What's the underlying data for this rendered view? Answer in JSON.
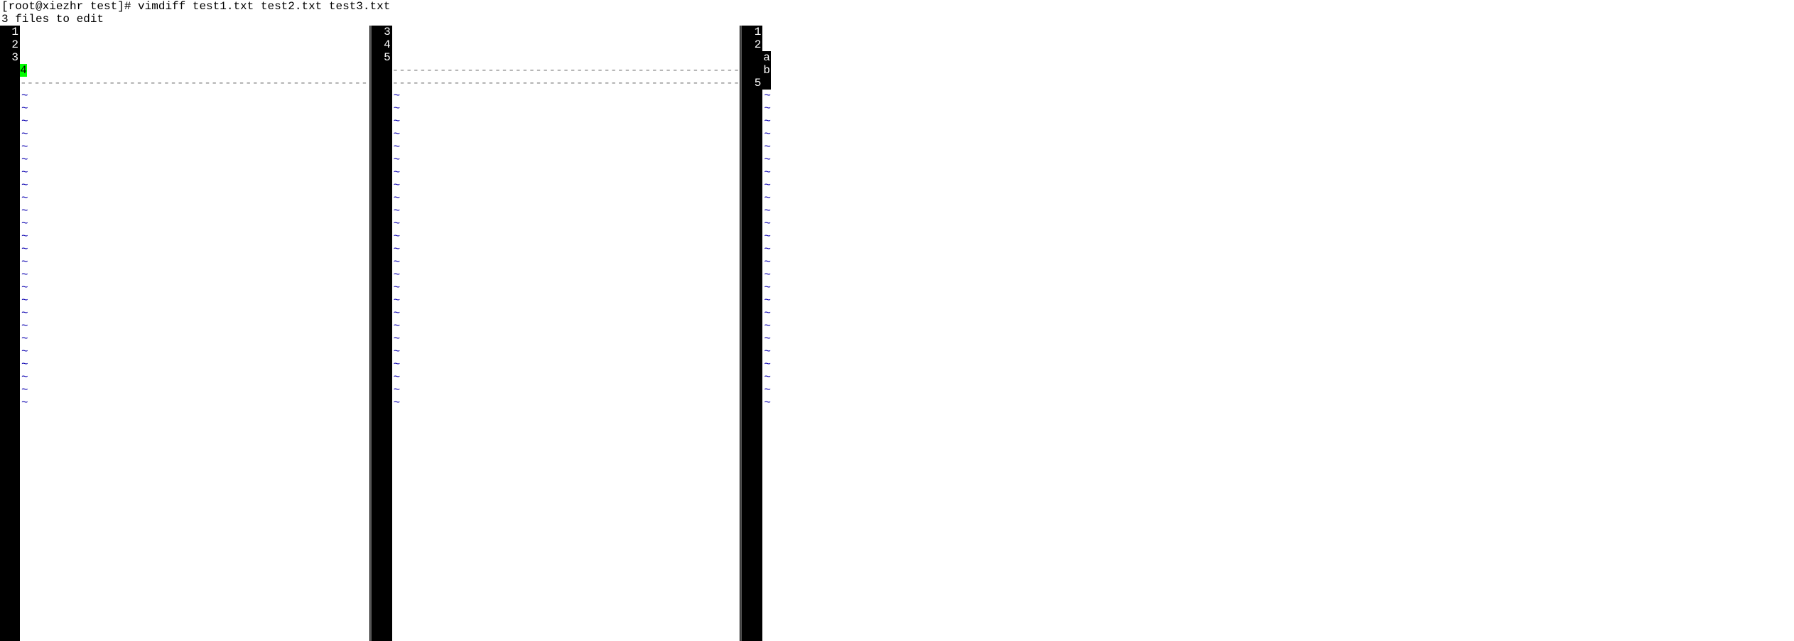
{
  "prompt": "[root@xiezhr test]# vimdiff test1.txt test2.txt test3.txt",
  "message": "3 files to edit",
  "tilde": "~",
  "pane1": {
    "ln1": "1",
    "ln2": "2",
    "ln3": "3",
    "ln4": "4"
  },
  "pane2": {
    "ln1": "3",
    "ln2": "4",
    "ln3": "5"
  },
  "pane3": {
    "ln1": "1",
    "ln2": "2",
    "ln3": "a",
    "ln4": "b",
    "ln5": "5"
  }
}
